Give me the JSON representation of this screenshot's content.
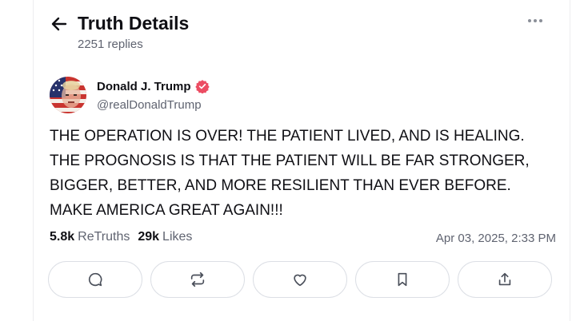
{
  "header": {
    "title": "Truth Details",
    "replies": "2251 replies"
  },
  "author": {
    "name": "Donald J. Trump",
    "handle": "@realDonaldTrump",
    "verified_color": "#ec4d63"
  },
  "post": {
    "lines": [
      "THE OPERATION IS OVER! THE PATIENT LIVED, AND IS HEALING.",
      "THE PROGNOSIS IS THAT THE PATIENT WILL BE FAR STRONGER,",
      "BIGGER, BETTER, AND MORE RESILIENT THAN EVER BEFORE.",
      "MAKE AMERICA GREAT AGAIN!!!"
    ]
  },
  "stats": {
    "retruths_count": "5.8k",
    "retruths_label": "ReTruths",
    "likes_count": "29k",
    "likes_label": "Likes",
    "date": "Apr 03, 2025, 2:33 PM"
  },
  "actions": [
    {
      "name": "reply",
      "icon": "comment-icon"
    },
    {
      "name": "retruth",
      "icon": "retruth-icon"
    },
    {
      "name": "like",
      "icon": "heart-icon"
    },
    {
      "name": "bookmark",
      "icon": "bookmark-icon"
    },
    {
      "name": "share",
      "icon": "share-icon"
    }
  ]
}
